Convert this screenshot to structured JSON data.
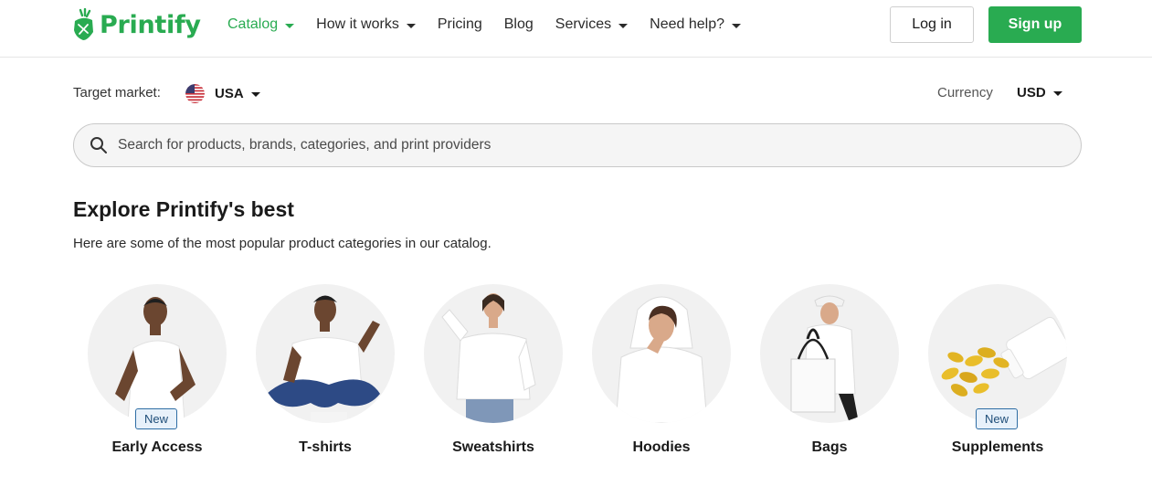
{
  "brand": {
    "name": "Printify",
    "color": "#29ab51"
  },
  "nav": {
    "items": [
      {
        "label": "Catalog",
        "dropdown": true,
        "active": true
      },
      {
        "label": "How it works",
        "dropdown": true
      },
      {
        "label": "Pricing",
        "dropdown": false
      },
      {
        "label": "Blog",
        "dropdown": false
      },
      {
        "label": "Services",
        "dropdown": true
      },
      {
        "label": "Need help?",
        "dropdown": true
      }
    ]
  },
  "auth": {
    "login_label": "Log in",
    "signup_label": "Sign up"
  },
  "market": {
    "label": "Target market:",
    "value": "USA",
    "flag_icon": "us-flag-icon"
  },
  "currency": {
    "label": "Currency",
    "value": "USD"
  },
  "search": {
    "placeholder": "Search for products, brands, categories, and print providers",
    "value": ""
  },
  "explore": {
    "title": "Explore Printify's best",
    "subtitle": "Here are some of the most popular product categories in our catalog."
  },
  "categories": [
    {
      "label": "Early Access",
      "badge": "New",
      "image": "man-in-white-tshirt"
    },
    {
      "label": "T-shirts",
      "badge": "",
      "image": "woman-sitting-white-tshirt"
    },
    {
      "label": "Sweatshirts",
      "badge": "",
      "image": "woman-white-sweatshirt"
    },
    {
      "label": "Hoodies",
      "badge": "",
      "image": "woman-white-hoodie"
    },
    {
      "label": "Bags",
      "badge": "",
      "image": "woman-with-tote-bag"
    },
    {
      "label": "Supplements",
      "badge": "New",
      "image": "supplement-capsules-bottle"
    }
  ]
}
